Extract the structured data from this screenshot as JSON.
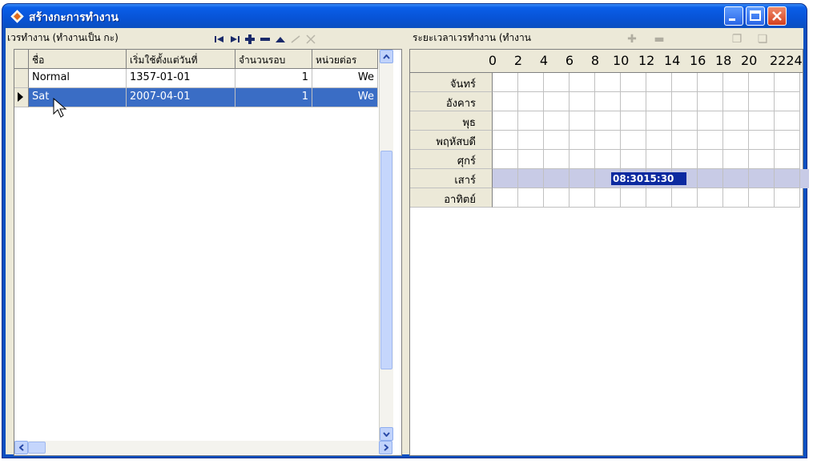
{
  "window": {
    "title": "สร้างกะการทำงาน",
    "controls": {
      "minimize": "minimize",
      "maximize": "maximize",
      "close": "close"
    }
  },
  "left_panel": {
    "caption": "เวรทำงาน (ทำงานเป็น กะ)",
    "nav_buttons": [
      "first-icon",
      "last-icon",
      "add-icon",
      "delete-icon",
      "up-icon",
      "confirm-icon",
      "cancel-icon"
    ],
    "columns": [
      "ชื่อ",
      "เริ่มใช้ตั้งแต่วันที่",
      "จำนวนรอบ",
      "หน่วยต่อร"
    ],
    "rows": [
      {
        "name": "Normal",
        "start_date": "1357-01-01",
        "rounds": "1",
        "unit": "We",
        "selected": false
      },
      {
        "name": "Sat",
        "start_date": "2007-04-01",
        "rounds": "1",
        "unit": "We",
        "selected": true
      }
    ]
  },
  "right_panel": {
    "caption": "ระยะเวลาเวรทำงาน (ทำงาน",
    "tools": [
      "add-period-icon",
      "remove-period-icon",
      "copy-icon",
      "paste-icon"
    ],
    "hours": [
      "0",
      "2",
      "4",
      "6",
      "8",
      "10",
      "12",
      "14",
      "16",
      "18",
      "20",
      "2224"
    ],
    "days": [
      "จันทร์",
      "อังคาร",
      "พุธ",
      "พฤหัสบดี",
      "ศุกร์",
      "เสาร์",
      "อาทิตย์"
    ],
    "selected_day": "เสาร์",
    "shift": {
      "day": "เสาร์",
      "label": "08:3015:30",
      "start_hour": 8.5,
      "end_hour": 15.5
    }
  }
}
